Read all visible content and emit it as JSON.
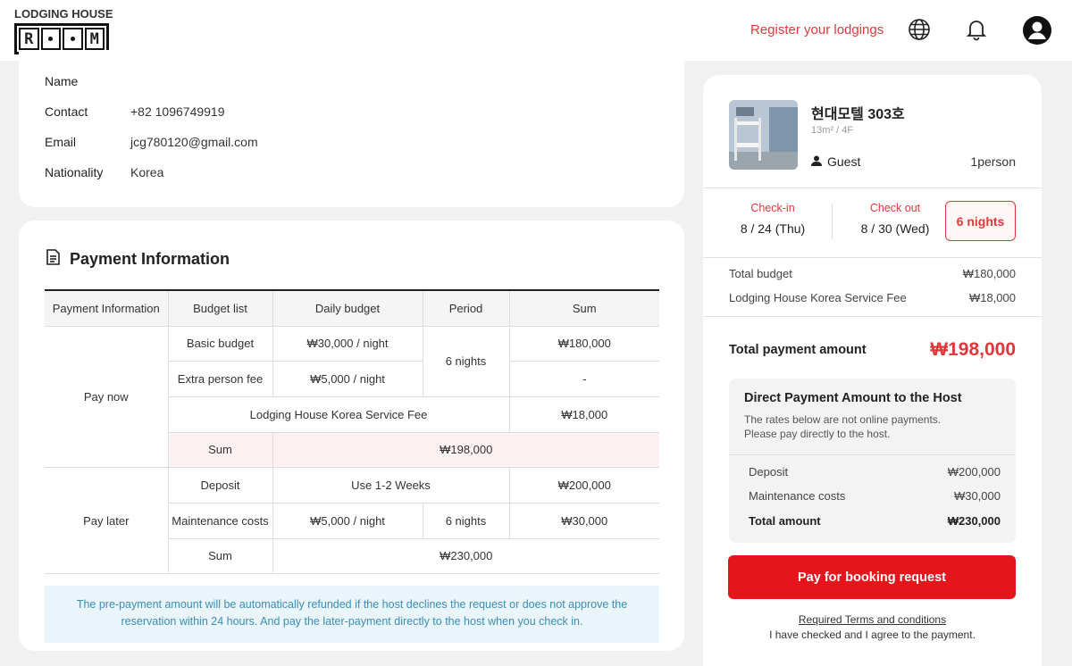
{
  "header": {
    "logo_top": "LODGING HOUSE",
    "logo_letters": [
      "R",
      "M"
    ],
    "register_link": "Register your lodgings",
    "icons": [
      "globe-icon",
      "bell-icon",
      "user-account-icon"
    ]
  },
  "contact": {
    "name_label": "Name",
    "name_value": "",
    "contact_label": "Contact",
    "contact_value": "+82 1096749919",
    "email_label": "Email",
    "email_value": "jcg780120@gmail.com",
    "nationality_label": "Nationality",
    "nationality_value": "Korea"
  },
  "payment": {
    "title": "Payment Information",
    "headers": [
      "Payment Information",
      "Budget list",
      "Daily budget",
      "Period",
      "Sum"
    ],
    "pay_now": {
      "label": "Pay now",
      "basic_budget": "Basic budget",
      "basic_daily": "₩30,000 / night",
      "period": "6 nights",
      "basic_sum": "₩180,000",
      "extra_fee": "Extra person fee",
      "extra_daily": "₩5,000 / night",
      "extra_sum": "-",
      "service_fee": "Lodging House Korea Service Fee",
      "service_sum": "₩18,000",
      "sum_label": "Sum",
      "sum_value": "₩198,000"
    },
    "pay_later": {
      "label": "Pay later",
      "deposit": "Deposit",
      "deposit_term": "Use 1-2 Weeks",
      "deposit_sum": "₩200,000",
      "maintenance": "Maintenance costs",
      "maintenance_daily": "₩5,000 / night",
      "maintenance_period": "6 nights",
      "maintenance_sum": "₩30,000",
      "sum_label": "Sum",
      "sum_value": "₩230,000"
    },
    "notice_line1": "The pre-payment amount will be automatically refunded if the host declines the request or does not approve the",
    "notice_line2": "reservation within 24 hours. And pay the later-payment directly to the host when you check in."
  },
  "summary": {
    "room_name": "현대모텔 303호",
    "room_size": "13m² / 4F",
    "guest_label": "Guest",
    "guest_count": "1person",
    "checkin_label": "Check-in",
    "checkin_value": "8 / 24  (Thu)",
    "checkout_label": "Check out",
    "checkout_value": "8 / 30  (Wed)",
    "nights": "6 nights",
    "total_budget_label": "Total budget",
    "total_budget_value": "₩180,000",
    "service_fee_label": "Lodging House Korea Service Fee",
    "service_fee_value": "₩18,000",
    "total_payment_label": "Total payment amount",
    "total_payment_value": "₩198,000",
    "direct_title": "Direct Payment Amount to the Host",
    "direct_desc1": "The rates below are not online payments.",
    "direct_desc2": "Please pay directly to the host.",
    "deposit_label": "Deposit",
    "deposit_value": "₩200,000",
    "maintenance_label": "Maintenance costs",
    "maintenance_value": "₩30,000",
    "total_amount_label": "Total amount",
    "total_amount_value": "₩230,000",
    "pay_button": "Pay for booking request",
    "terms_link": "Required Terms and conditions",
    "terms_text": "I have checked and I agree to the payment."
  },
  "colors": {
    "accent": "#e6141b",
    "accent_text": "#e0383a",
    "notice_bg": "#e9f5fb",
    "notice_text": "#3b8db5"
  }
}
